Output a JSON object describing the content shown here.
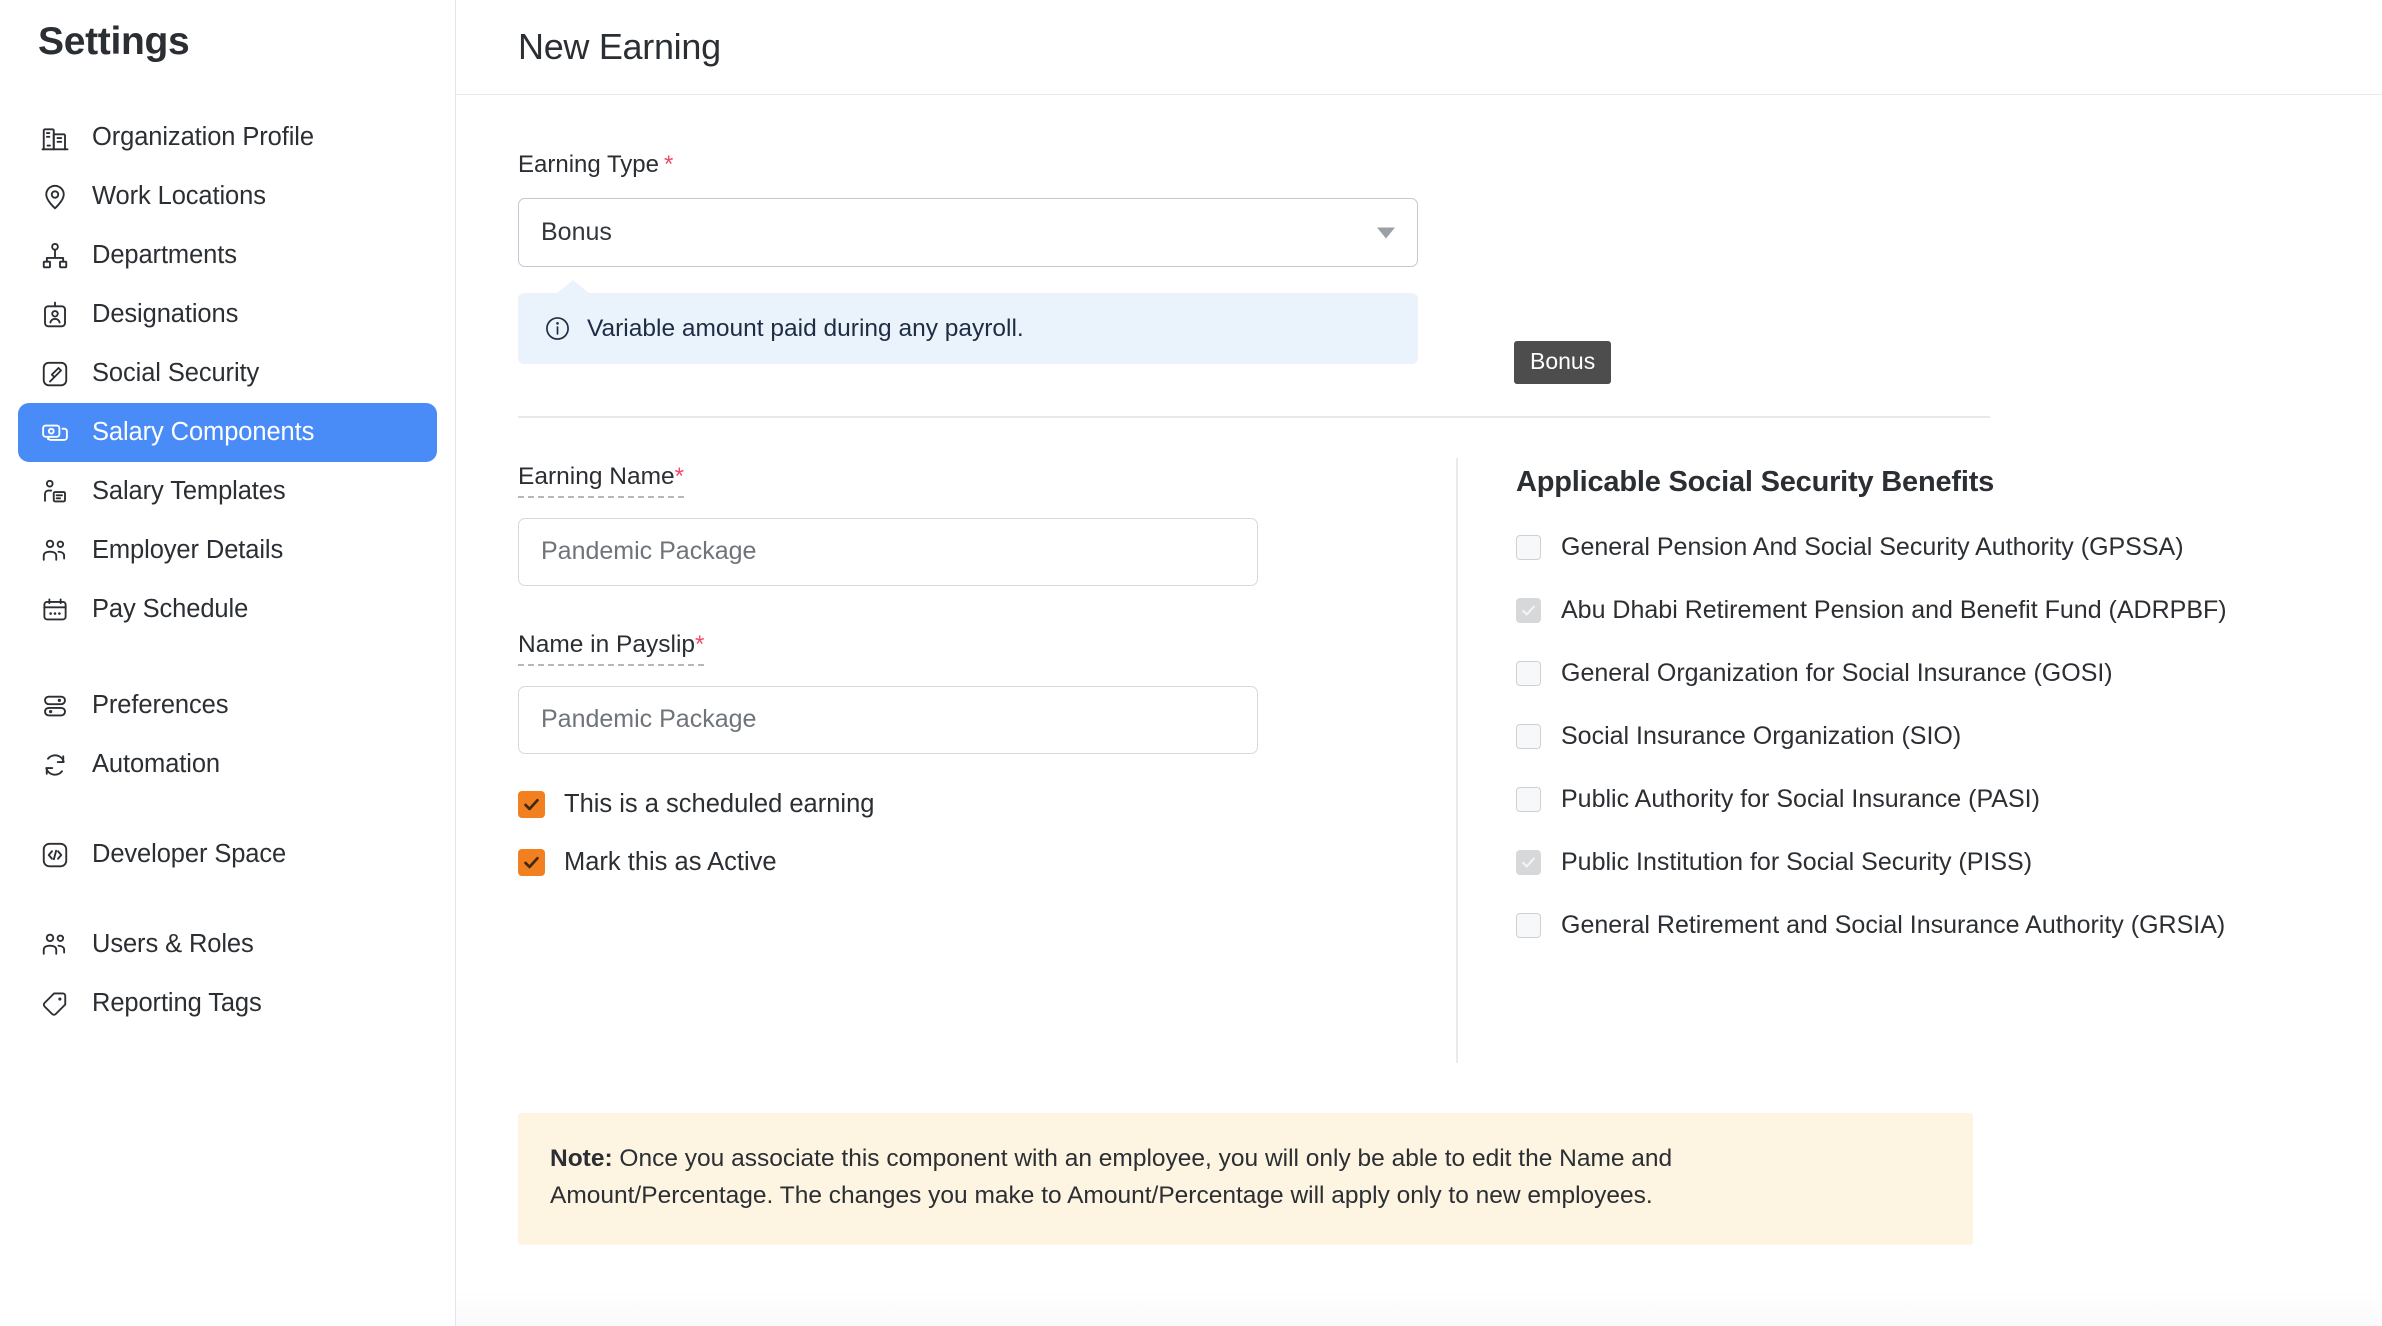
{
  "sidebar": {
    "title": "Settings",
    "items": [
      {
        "label": "Organization Profile",
        "icon": "building-icon",
        "active": false
      },
      {
        "label": "Work Locations",
        "icon": "map-pin-icon",
        "active": false
      },
      {
        "label": "Departments",
        "icon": "org-chart-icon",
        "active": false
      },
      {
        "label": "Designations",
        "icon": "id-badge-icon",
        "active": false
      },
      {
        "label": "Social Security",
        "icon": "gavel-icon",
        "active": false
      },
      {
        "label": "Salary Components",
        "icon": "cards-stack-icon",
        "active": true
      },
      {
        "label": "Salary Templates",
        "icon": "person-document-icon",
        "active": false
      },
      {
        "label": "Employer Details",
        "icon": "people-icon",
        "active": false
      },
      {
        "label": "Pay Schedule",
        "icon": "calendar-dots-icon",
        "active": false
      },
      {
        "label": "Preferences",
        "icon": "sliders-icon",
        "active": false
      },
      {
        "label": "Automation",
        "icon": "refresh-icon",
        "active": false
      },
      {
        "label": "Developer Space",
        "icon": "code-brackets-icon",
        "active": false
      },
      {
        "label": "Users & Roles",
        "icon": "people-icon",
        "active": false
      },
      {
        "label": "Reporting Tags",
        "icon": "tag-icon",
        "active": false
      }
    ]
  },
  "header": {
    "title": "New Earning"
  },
  "form": {
    "earning_type_label": "Earning Type",
    "required_marker": "*",
    "earning_type_value": "Bonus",
    "earning_type_tooltip": "Bonus",
    "info_text": "Variable amount paid during any payroll.",
    "earning_name_label": "Earning Name",
    "earning_name_placeholder": "Pandemic Package",
    "earning_name_value": "",
    "payslip_name_label": "Name in Payslip",
    "payslip_name_placeholder": "Pandemic Package",
    "payslip_name_value": "",
    "checkboxes": [
      {
        "label": "This is a scheduled earning",
        "checked": true
      },
      {
        "label": "Mark this as Active",
        "checked": true
      }
    ]
  },
  "benefits": {
    "title": "Applicable Social Security Benefits",
    "items": [
      {
        "label": "General Pension And Social Security Authority (GPSSA)",
        "checked": false
      },
      {
        "label": "Abu Dhabi Retirement Pension and Benefit Fund (ADRPBF)",
        "checked": true
      },
      {
        "label": "General Organization for Social Insurance (GOSI)",
        "checked": false
      },
      {
        "label": "Social Insurance Organization (SIO)",
        "checked": false
      },
      {
        "label": "Public Authority for Social Insurance (PASI)",
        "checked": false
      },
      {
        "label": "Public Institution for Social Security (PISS)",
        "checked": true
      },
      {
        "label": "General Retirement and Social Insurance Authority (GRSIA)",
        "checked": false
      }
    ]
  },
  "note": {
    "prefix": "Note:",
    "body": " Once you associate this component with an employee, you will only be able to edit the Name and Amount/Percentage. The changes you make to Amount/Percentage will apply only to new employees."
  },
  "colors": {
    "accent_blue": "#4a8cf7",
    "checkbox_orange": "#f28021",
    "required_red": "#f2496b",
    "info_bg": "#eaf2fb",
    "note_bg": "#fdf4e2",
    "tooltip_bg": "#4d4d4d"
  }
}
